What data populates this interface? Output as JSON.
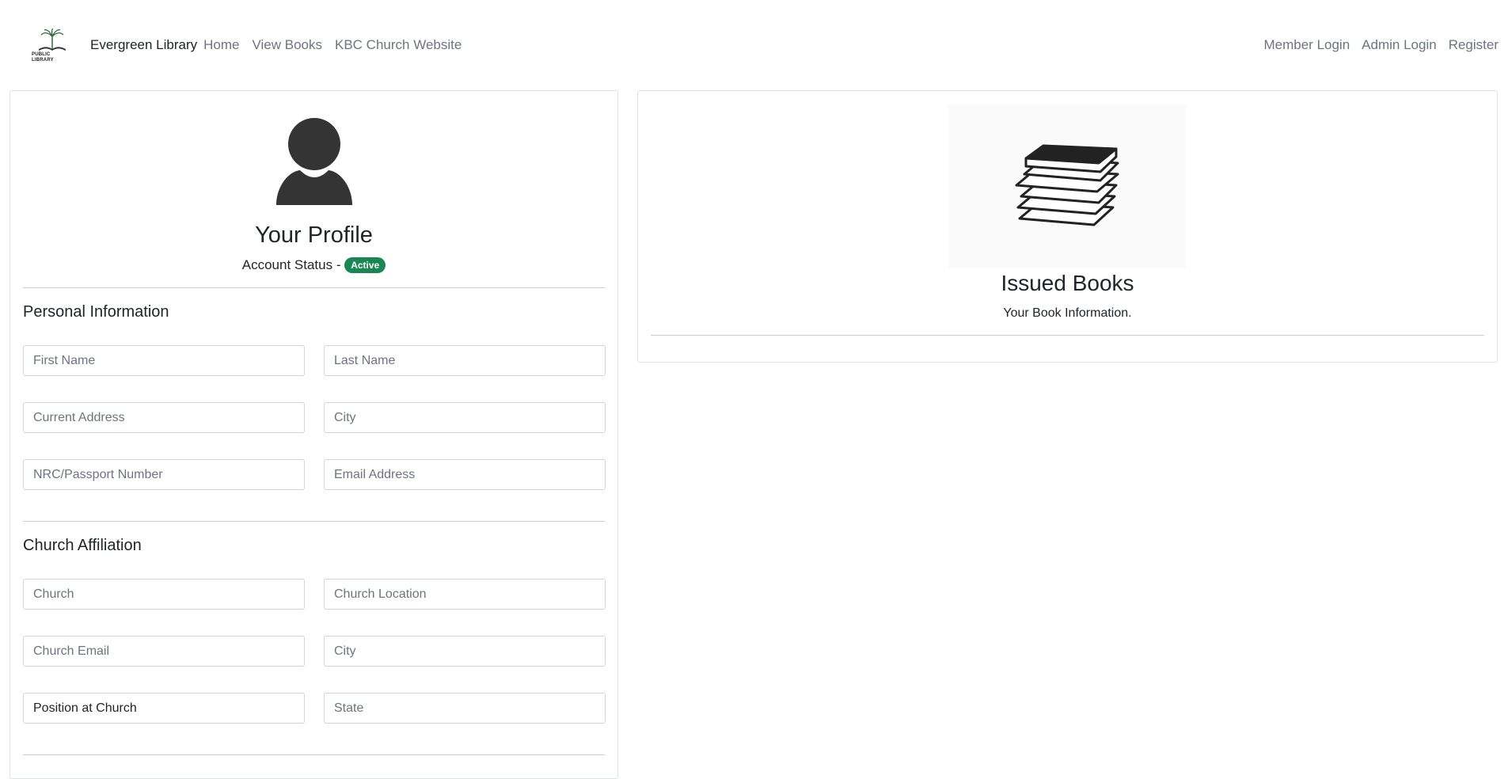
{
  "navbar": {
    "logo_text": "PUBLIC LIBRARY",
    "brand": "Evergreen Library",
    "links": [
      "Home",
      "View Books",
      "KBC Church Website"
    ],
    "right_links": [
      "Member Login",
      "Admin Login",
      "Register"
    ]
  },
  "profile": {
    "title": "Your Profile",
    "status_label": "Account Status - ",
    "status_badge": "Active",
    "status_color": "#198754",
    "avatar_icon": "user-silhouette-icon"
  },
  "personal": {
    "title": "Personal Information",
    "first_name": {
      "placeholder": "First Name",
      "value": ""
    },
    "last_name": {
      "placeholder": "Last Name",
      "value": ""
    },
    "address": {
      "placeholder": "Current Address",
      "value": ""
    },
    "city": {
      "placeholder": "City",
      "value": ""
    },
    "nrc": {
      "placeholder": "NRC/Passport Number",
      "value": ""
    },
    "email": {
      "placeholder": "Email Address",
      "value": ""
    }
  },
  "church": {
    "title": "Church Affiliation",
    "church": {
      "placeholder": "Church",
      "value": ""
    },
    "location": {
      "placeholder": "Church Location",
      "value": ""
    },
    "email": {
      "placeholder": "Church Email",
      "value": ""
    },
    "city": {
      "placeholder": "City",
      "value": ""
    },
    "position": {
      "placeholder": "Position at Church",
      "value": "Position at Church"
    },
    "state": {
      "placeholder": "State",
      "value": ""
    }
  },
  "books": {
    "title": "Issued Books",
    "subtitle": "Your Book Information.",
    "image_icon": "book-stack-icon"
  }
}
